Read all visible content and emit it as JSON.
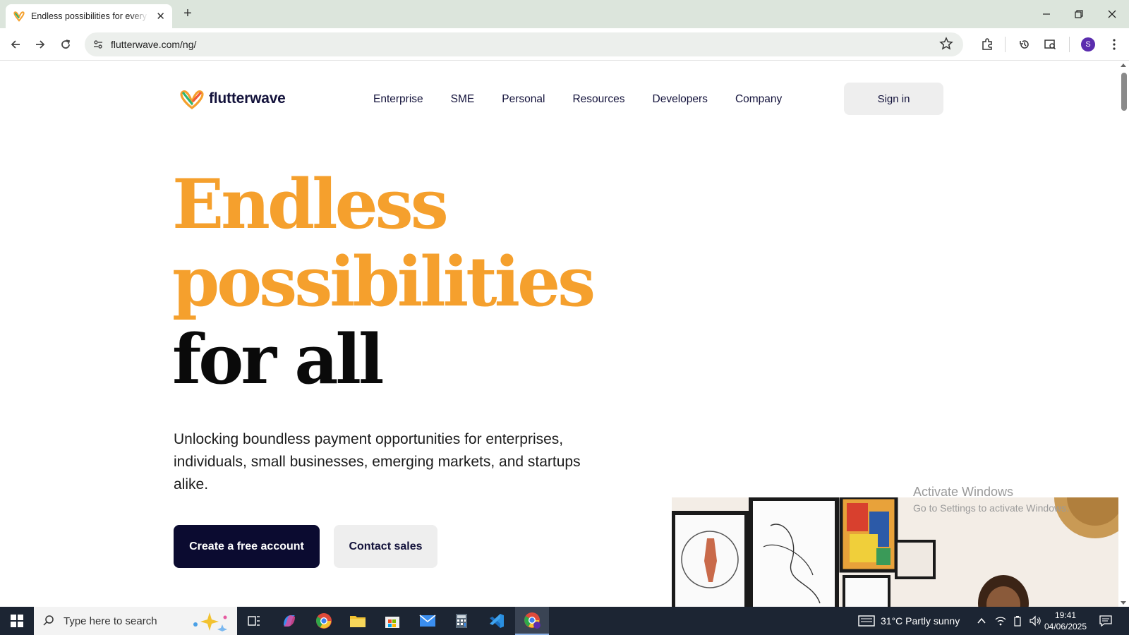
{
  "browser": {
    "tab_title": "Endless possibilities for every business",
    "url": "flutterwave.com/ng/",
    "profile_initial": "S"
  },
  "site": {
    "logo_text": "flutterwave",
    "nav": [
      "Enterprise",
      "SME",
      "Personal",
      "Resources",
      "Developers",
      "Company"
    ],
    "signin_label": "Sign in",
    "hero_line1": "Endless",
    "hero_line2": "possibilities",
    "hero_line3": "for all",
    "subtitle": "Unlocking boundless payment opportunities for enterprises, individuals, small businesses, emerging markets, and startups alike.",
    "cta_primary": "Create a free account",
    "cta_secondary": "Contact sales",
    "accent_color": "#f5a02d",
    "dark_color": "#0b0b30"
  },
  "watermark": {
    "line1": "Activate Windows",
    "line2": "Go to Settings to activate Windows."
  },
  "taskbar": {
    "search_placeholder": "Type here to search",
    "weather": "31°C  Partly sunny",
    "time": "19:41",
    "date": "04/06/2025"
  }
}
